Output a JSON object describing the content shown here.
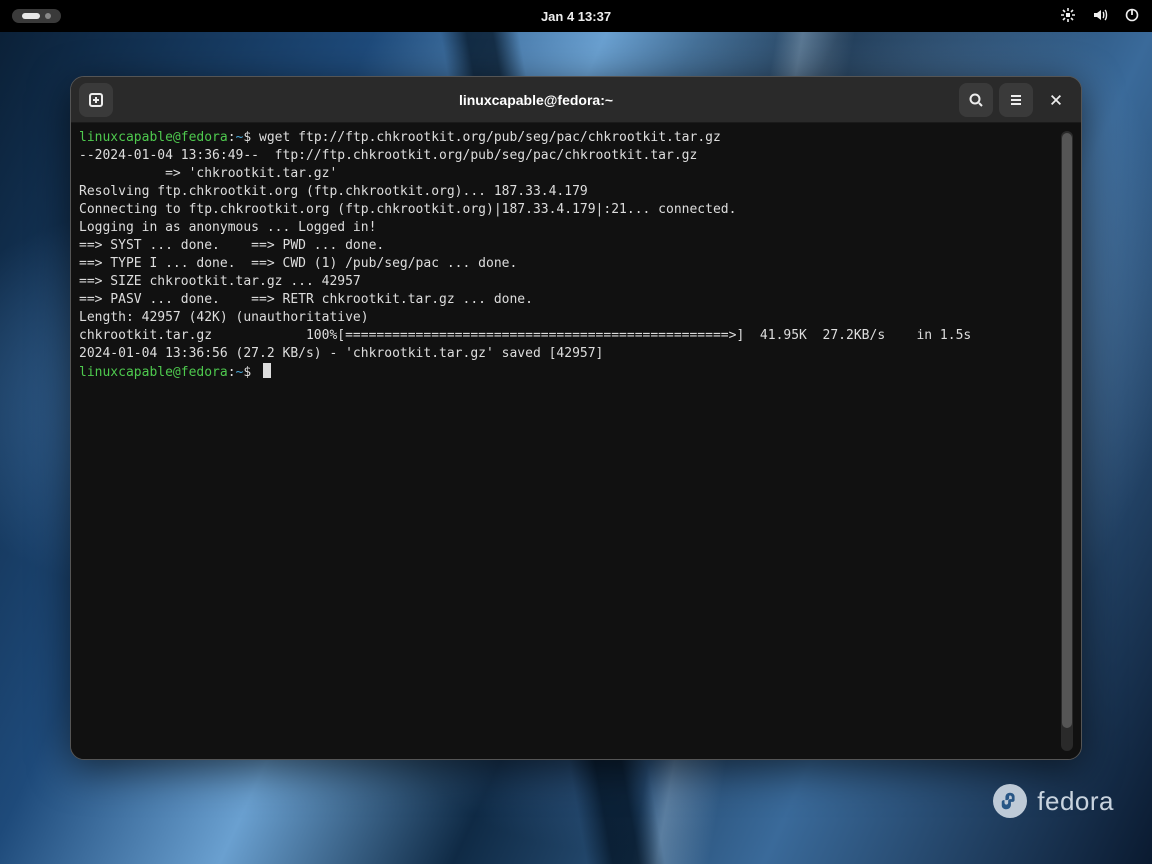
{
  "topbar": {
    "datetime": "Jan 4  13:37"
  },
  "terminal": {
    "title": "linuxcapable@fedora:~",
    "prompt": {
      "user_host": "linuxcapable@fedora",
      "sep": ":",
      "path": "~",
      "symbol": "$ "
    },
    "command": "wget ftp://ftp.chkrootkit.org/pub/seg/pac/chkrootkit.tar.gz",
    "output": [
      "--2024-01-04 13:36:49--  ftp://ftp.chkrootkit.org/pub/seg/pac/chkrootkit.tar.gz",
      "           => 'chkrootkit.tar.gz'",
      "Resolving ftp.chkrootkit.org (ftp.chkrootkit.org)... 187.33.4.179",
      "Connecting to ftp.chkrootkit.org (ftp.chkrootkit.org)|187.33.4.179|:21... connected.",
      "Logging in as anonymous ... Logged in!",
      "==> SYST ... done.    ==> PWD ... done.",
      "==> TYPE I ... done.  ==> CWD (1) /pub/seg/pac ... done.",
      "==> SIZE chkrootkit.tar.gz ... 42957",
      "==> PASV ... done.    ==> RETR chkrootkit.tar.gz ... done.",
      "Length: 42957 (42K) (unauthoritative)",
      "",
      "chkrootkit.tar.gz            100%[=================================================>]  41.95K  27.2KB/s    in 1.5s",
      "",
      "2024-01-04 13:36:56 (27.2 KB/s) - 'chkrootkit.tar.gz' saved [42957]",
      ""
    ]
  },
  "watermark": {
    "text": "fedora"
  }
}
